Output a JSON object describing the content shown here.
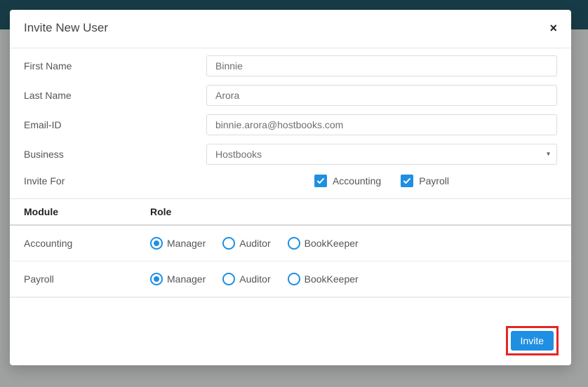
{
  "modal": {
    "title": "Invite New User",
    "close_symbol": "×"
  },
  "labels": {
    "first_name": "First Name",
    "last_name": "Last Name",
    "email": "Email-ID",
    "business": "Business",
    "invite_for": "Invite For"
  },
  "values": {
    "first_name": "Binnie",
    "last_name": "Arora",
    "email": "binnie.arora@hostbooks.com",
    "business": "Hostbooks"
  },
  "invite_options": {
    "accounting": "Accounting",
    "payroll": "Payroll"
  },
  "table": {
    "header_module": "Module",
    "header_role": "Role",
    "modules": {
      "accounting": "Accounting",
      "payroll": "Payroll"
    },
    "roles": {
      "manager": "Manager",
      "auditor": "Auditor",
      "bookkeeper": "BookKeeper"
    }
  },
  "buttons": {
    "invite": "Invite"
  }
}
